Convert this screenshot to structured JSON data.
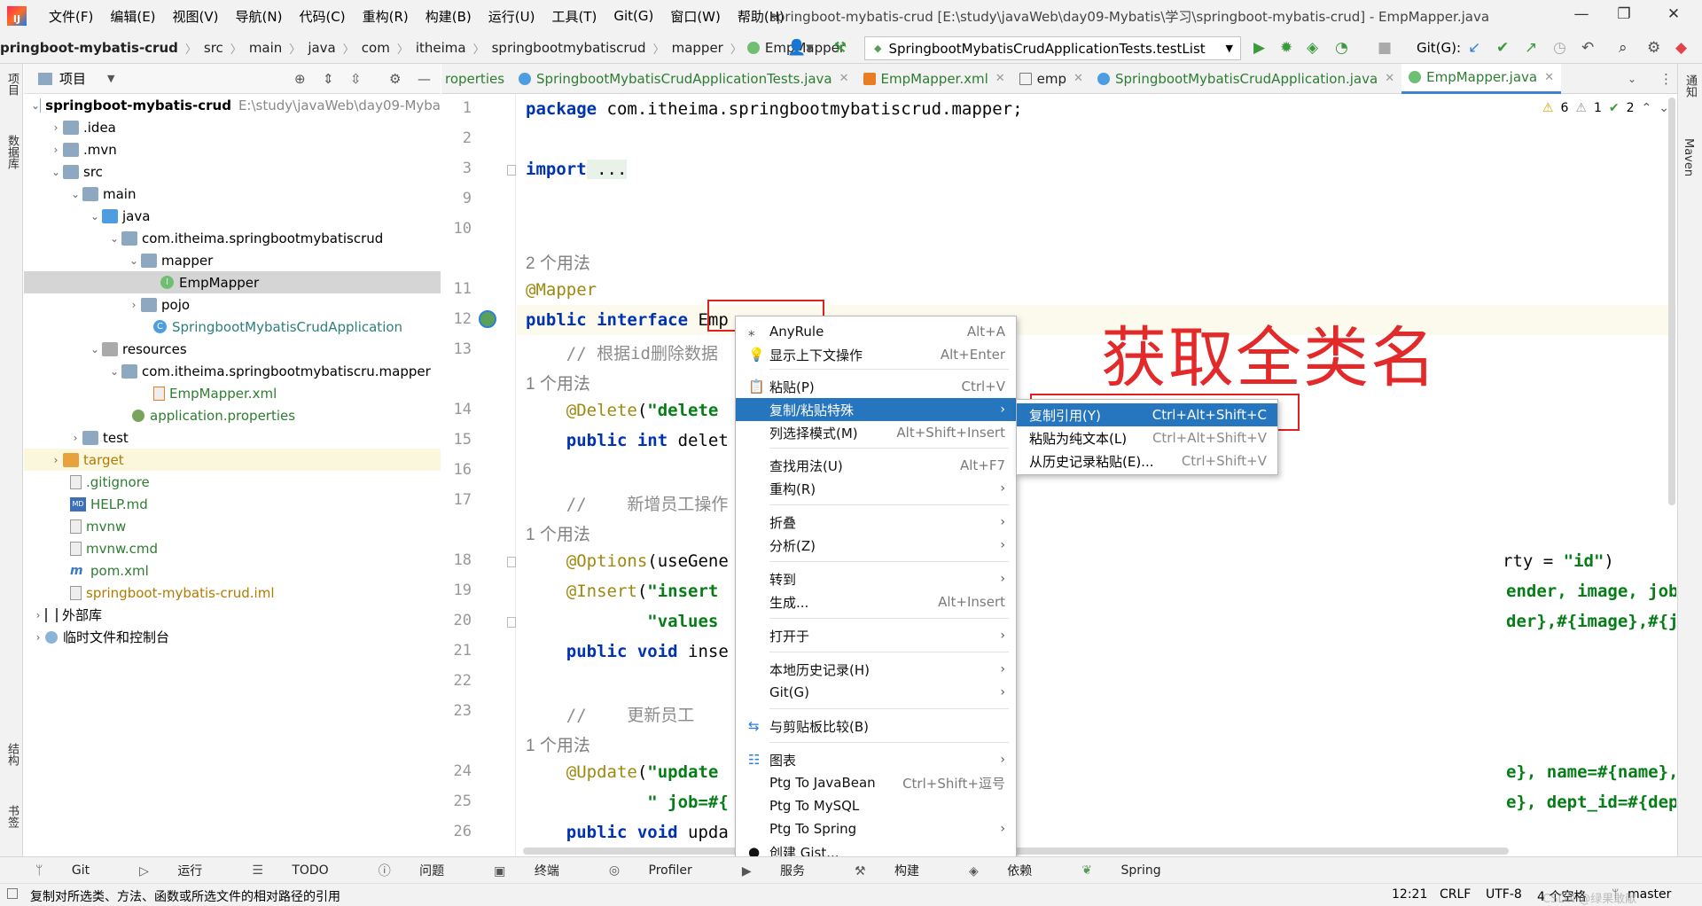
{
  "titlebar": {
    "logo": "IJ",
    "menu": [
      "文件(F)",
      "编辑(E)",
      "视图(V)",
      "导航(N)",
      "代码(C)",
      "重构(R)",
      "构建(B)",
      "运行(U)",
      "工具(T)",
      "Git(G)",
      "窗口(W)",
      "帮助(H)"
    ],
    "window_title": "springboot-mybatis-crud [E:\\study\\javaWeb\\day09-Mybatis\\学习\\springboot-mybatis-crud] - EmpMapper.java",
    "minimize": "—",
    "restore": "❐",
    "close": "✕"
  },
  "navbar": {
    "breadcrumb": [
      "pringboot-mybatis-crud",
      "src",
      "main",
      "java",
      "com",
      "itheima",
      "springbootmybatiscrud",
      "mapper",
      "EmpMapper"
    ],
    "run_config": "SpringbootMybatisCrudApplicationTests.testList",
    "git_label": "Git(G):"
  },
  "left_strip": {
    "labels": [
      "项目",
      "数据库",
      "结构",
      "书签"
    ]
  },
  "right_strip": {
    "labels": [
      "通知",
      "Maven"
    ]
  },
  "project_panel": {
    "title": "项目",
    "tree": [
      {
        "label": "springboot-mybatis-crud",
        "extra": "E:\\study\\javaWeb\\day09-Myba"
      },
      {
        "label": ".idea"
      },
      {
        "label": ".mvn"
      },
      {
        "label": "src"
      },
      {
        "label": "main"
      },
      {
        "label": "java"
      },
      {
        "label": "com.itheima.springbootmybatiscrud"
      },
      {
        "label": "mapper"
      },
      {
        "label": "EmpMapper"
      },
      {
        "label": "pojo"
      },
      {
        "label": "SpringbootMybatisCrudApplication"
      },
      {
        "label": "resources"
      },
      {
        "label": "com.itheima.springbootmybatiscru.mapper"
      },
      {
        "label": "EmpMapper.xml"
      },
      {
        "label": "application.properties"
      },
      {
        "label": "test"
      },
      {
        "label": "target"
      },
      {
        "label": ".gitignore"
      },
      {
        "label": "HELP.md"
      },
      {
        "label": "mvnw"
      },
      {
        "label": "mvnw.cmd"
      },
      {
        "label": "pom.xml"
      },
      {
        "label": "springboot-mybatis-crud.iml"
      },
      {
        "label": "外部库"
      },
      {
        "label": "临时文件和控制台"
      }
    ]
  },
  "tabs": [
    "roperties",
    "SpringbootMybatisCrudApplicationTests.java",
    "EmpMapper.xml",
    "emp",
    "SpringbootMybatisCrudApplication.java",
    "EmpMapper.java"
  ],
  "inspections": {
    "warn": "6",
    "weak": "1",
    "ok": "2"
  },
  "editor": {
    "line_numbers": [
      "1",
      "2",
      "3",
      "9",
      "10",
      "",
      "11",
      "12",
      "13",
      "",
      "14",
      "15",
      "16",
      "17",
      "",
      "18",
      "19",
      "20",
      "21",
      "22",
      "23",
      "",
      "24",
      "25",
      "26"
    ],
    "usages": {
      "two": "2 个用法",
      "one": "1 个用法"
    },
    "code": {
      "l1a": "package",
      "l1b": " com.itheima.springbootmybatiscrud.mapper;",
      "l3a": "import",
      "l3b": " ...",
      "l11": "@Mapper",
      "l12a": "public interface",
      "l12b": " Emp",
      "l13": "    // 根据id删除数据",
      "l14a": "    @Delete",
      "l14b": "(",
      "l14c": "\"delete",
      "l15a": "    public int",
      "l15b": " delet",
      "l17": "    //    新增员工操作",
      "l18a": "    @Options",
      "l18b": "(useGene",
      "l18c": "rty = ",
      "l18d": "\"id\"",
      "l18e": ")",
      "l19a": "    @Insert",
      "l19b": "(",
      "l19c": "\"insert",
      "l19d": "ender, image, job, entrydate, dept_id, create_time, update_time",
      "l20a": "            \"values",
      "l20b": "der},#{image},#{job},#{entrydate},#{deptId},#{createTime},#{upd",
      "l21a": "    public void",
      "l21b": " inse",
      "l23": "    //    更新员工",
      "l24a": "    @Update",
      "l24b": "(",
      "l24c": "\"update",
      "l24d": "e}, name=#{name}, gender=#{gender}, image=#{image},\" +",
      "l25a": "            \" job=#{",
      "l25b": "e}, dept_id=#{deptId},update_time=#{createTime} where id = #{id",
      "l26a": "    public void",
      "l26b": " upda"
    }
  },
  "context_menu": {
    "items": [
      {
        "label": "AnyRule",
        "shortcut": "Alt+A",
        "icon": "regex-icon"
      },
      {
        "label": "显示上下文操作",
        "shortcut": "Alt+Enter",
        "icon": "bulb-icon"
      },
      {
        "label": "粘贴(P)",
        "shortcut": "Ctrl+V",
        "icon": "paste-icon"
      },
      {
        "label": "复制/粘贴特殊",
        "submenu": true
      },
      {
        "label": "列选择模式(M)",
        "shortcut": "Alt+Shift+Insert"
      },
      {
        "label": "查找用法(U)",
        "shortcut": "Alt+F7"
      },
      {
        "label": "重构(R)",
        "submenu": true
      },
      {
        "label": "折叠",
        "submenu": true
      },
      {
        "label": "分析(Z)",
        "submenu": true
      },
      {
        "label": "转到",
        "submenu": true
      },
      {
        "label": "生成...",
        "shortcut": "Alt+Insert"
      },
      {
        "label": "打开于",
        "submenu": true
      },
      {
        "label": "本地历史记录(H)",
        "submenu": true
      },
      {
        "label": "Git(G)",
        "submenu": true
      },
      {
        "label": "与剪贴板比较(B)",
        "icon": "compare-icon"
      },
      {
        "label": "图表",
        "submenu": true,
        "icon": "diagram-icon"
      },
      {
        "label": "Ptg To JavaBean",
        "shortcut": "Ctrl+Shift+逗号"
      },
      {
        "label": "Ptg To MySQL"
      },
      {
        "label": "Ptg To Spring",
        "submenu": true
      },
      {
        "label": "创建 Gist...",
        "icon": "github-icon"
      }
    ],
    "submenu": [
      {
        "label": "复制引用(Y)",
        "shortcut": "Ctrl+Alt+Shift+C"
      },
      {
        "label": "粘贴为纯文本(L)",
        "shortcut": "Ctrl+Alt+Shift+V"
      },
      {
        "label": "从历史记录粘贴(E)...",
        "shortcut": "Ctrl+Shift+V"
      }
    ]
  },
  "annotation": "获取全类名",
  "bottom_tools": [
    "Git",
    "运行",
    "TODO",
    "问题",
    "终端",
    "Profiler",
    "服务",
    "构建",
    "依赖",
    "Spring"
  ],
  "statusbar": {
    "message": "复制对所选类、方法、函数或所选文件的相对路径的引用",
    "position": "12:21",
    "line_sep": "CRLF",
    "encoding": "UTF-8",
    "indent": "4 个空格",
    "branch": "master",
    "watermark": "CSDN @绿果敢献"
  },
  "colors": {
    "accent": "#2675bf",
    "annotation_red": "#e22a2a"
  }
}
